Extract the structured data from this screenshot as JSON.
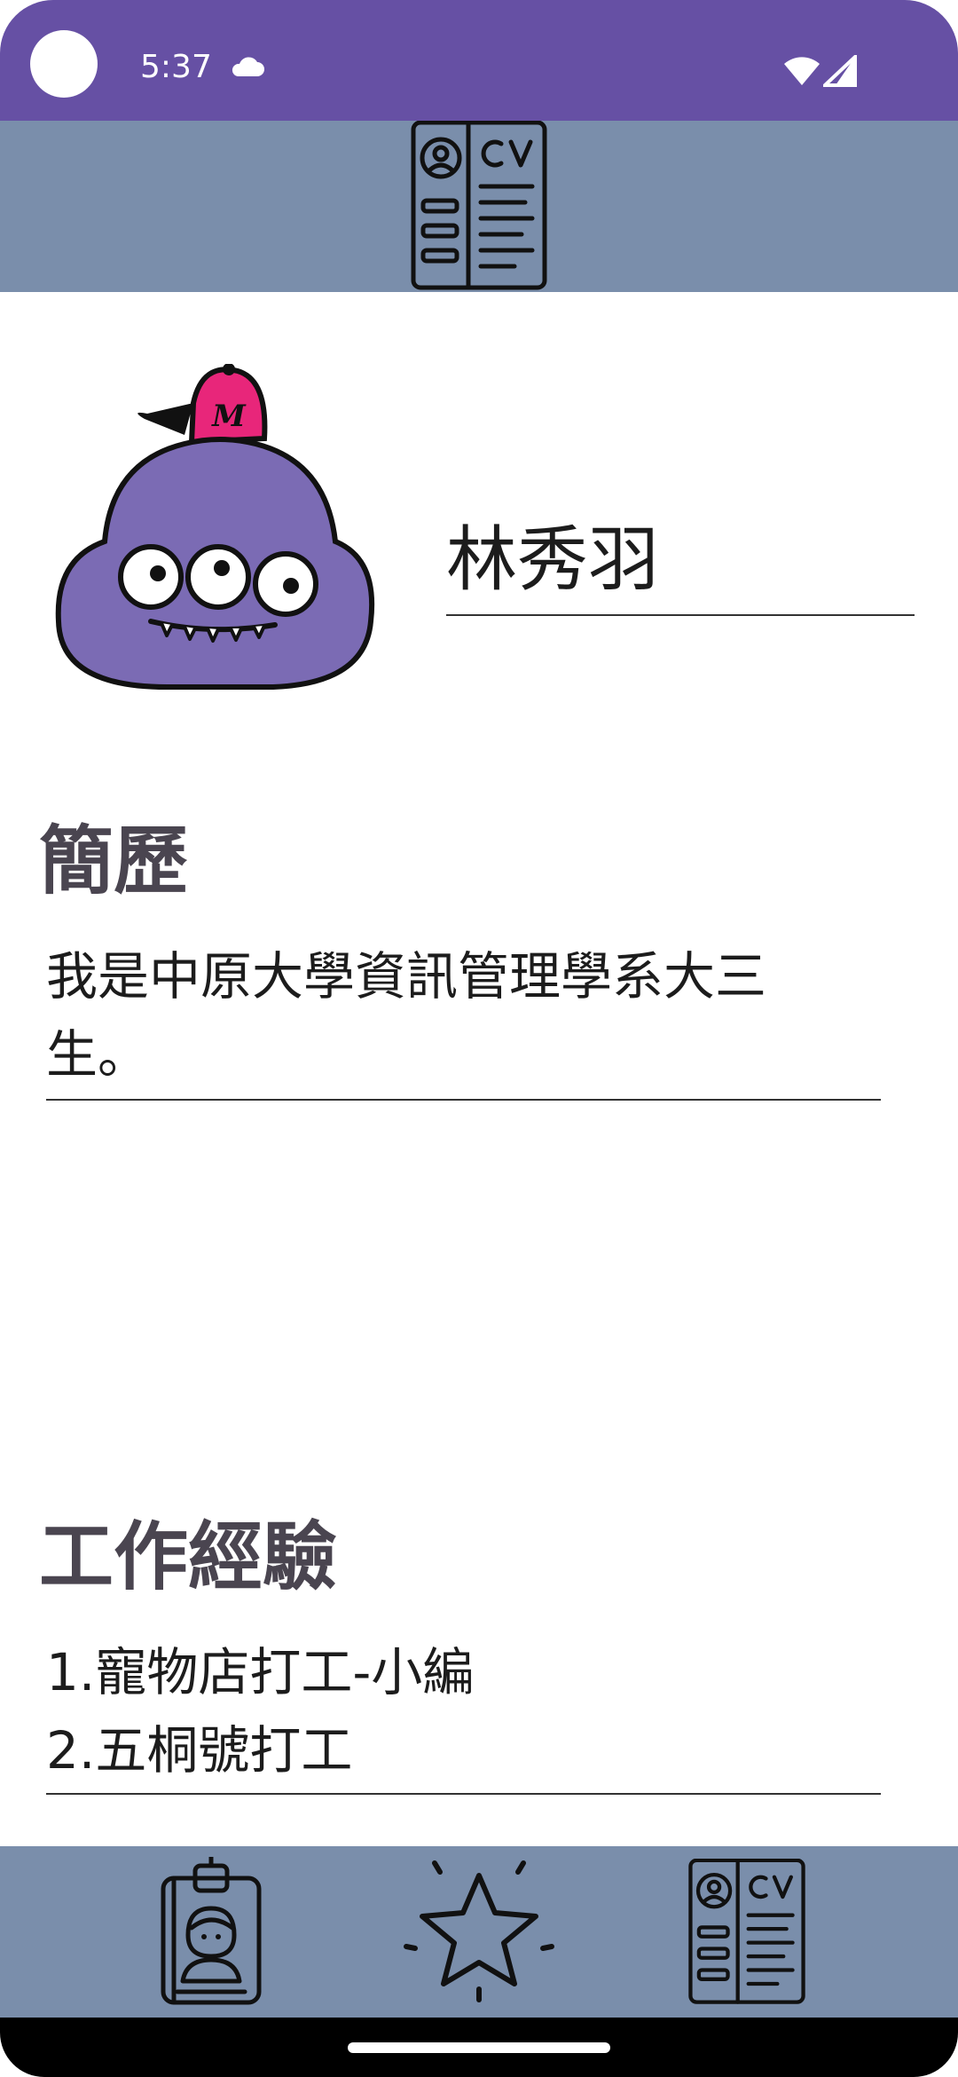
{
  "status_bar": {
    "time": "5:37"
  },
  "profile": {
    "name": "林秀羽"
  },
  "sections": {
    "resume": {
      "title": "簡歷",
      "content": "我是中原大學資訊管理學系大三\n生。"
    },
    "work": {
      "title": "工作經驗",
      "content": "1.寵物店打工-小編\n2.五桐號打工"
    }
  },
  "icons": {
    "header": "cv-icon",
    "nav": [
      "id-badge-icon",
      "star-icon",
      "cv-icon"
    ]
  },
  "colors": {
    "status_bar": "#6650a4",
    "app_bar": "#7a8eab",
    "bottom_nav": "#7a8eab",
    "avatar_body": "#7b6bb4",
    "cap": "#e8267a"
  }
}
